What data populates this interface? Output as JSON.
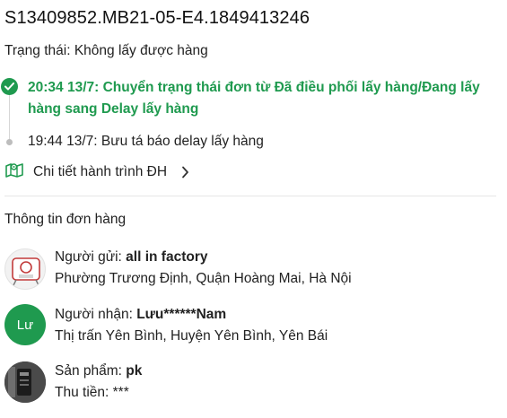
{
  "order": {
    "code": "S13409852.MB21-05-E4.1849413246",
    "status_label": "Trạng thái:",
    "status_value": "Không lấy được hàng"
  },
  "timeline": {
    "events": [
      {
        "time": "20:34 13/7:",
        "text": "Chuyển trạng thái đơn từ Đã điều phối lấy hàng/Đang lấy hàng sang Delay lấy hàng"
      },
      {
        "time": "19:44 13/7:",
        "text": "Bưu tá báo delay lấy hàng"
      }
    ],
    "route_link_label": "Chi tiết hành trình ĐH"
  },
  "order_info": {
    "title": "Thông tin đơn hàng",
    "sender": {
      "label": "Người gửi:",
      "name": "all in factory",
      "address": "Phường Trương Định, Quận Hoàng Mai, Hà Nội"
    },
    "receiver": {
      "label": "Người nhận:",
      "name": "Lưu******Nam",
      "initials": "Lư",
      "address": "Thị trấn Yên Bình, Huyện Yên Bình, Yên Bái"
    },
    "product": {
      "label": "Sản phẩm:",
      "name": "pk",
      "collect_label": "Thu tiền:",
      "collect_value": "***"
    }
  },
  "colors": {
    "accent_green": "#1f9a4f",
    "text": "#222222",
    "divider": "#e6e6e6"
  },
  "icons": {
    "status_check": "check-circle-icon",
    "route": "map-pin-icon",
    "chevron": "chevron-right-icon"
  }
}
